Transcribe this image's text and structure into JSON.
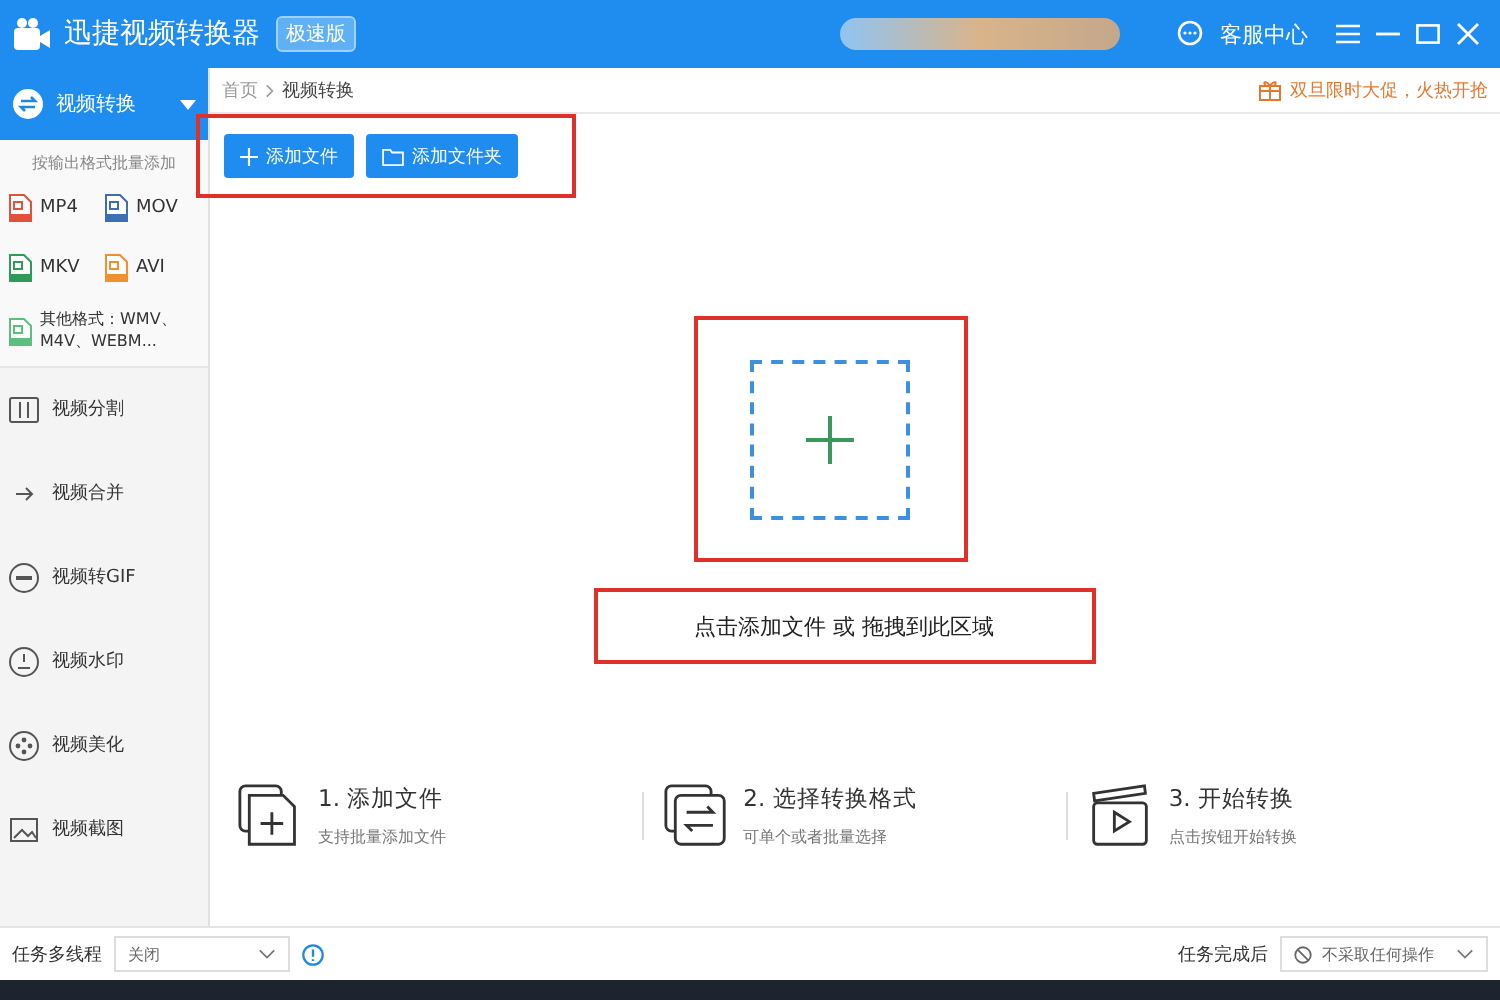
{
  "title_bar": {
    "app_name": "迅捷视频转换器",
    "edition_badge": "极速版",
    "support": "客服中心"
  },
  "sidebar": {
    "header": {
      "label": "视频转换",
      "selected": true
    },
    "hint": "按输出格式批量添加",
    "formats": [
      {
        "label": "MP4",
        "color": "#e0533a"
      },
      {
        "label": "MOV",
        "color": "#3b6fb6"
      },
      {
        "label": "MKV",
        "color": "#2e9b58"
      },
      {
        "label": "AVI",
        "color": "#f0902e"
      }
    ],
    "other_format": "其他格式：WMV、M4V、WEBM...",
    "items": [
      {
        "label": "视频分割",
        "kind": "split"
      },
      {
        "label": "视频合并",
        "kind": "merge"
      },
      {
        "label": "视频转GIF",
        "kind": "gif"
      },
      {
        "label": "视频水印",
        "kind": "watermark"
      },
      {
        "label": "视频美化",
        "kind": "beautify"
      },
      {
        "label": "视频截图",
        "kind": "screenshot"
      }
    ]
  },
  "breadcrumb": [
    "首页",
    "视频转换"
  ],
  "promo": "双旦限时大促，火热开抢",
  "buttons": [
    {
      "label": "添加文件",
      "kind": "file"
    },
    {
      "label": "添加文件夹",
      "kind": "folder"
    }
  ],
  "drop_hint": "点击添加文件 或 拖拽到此区域",
  "steps": [
    {
      "title": "1. 添加文件",
      "desc": "支持批量添加文件",
      "kind": "add"
    },
    {
      "title": "2. 选择转换格式",
      "desc": "可单个或者批量选择",
      "kind": "format"
    },
    {
      "title": "3. 开始转换",
      "desc": "点击按钮开始转换",
      "kind": "start"
    }
  ],
  "status_bar": {
    "multithread_label": "任务多线程",
    "multithread_value": "关闭",
    "after_label": "任务完成后",
    "after_value": "不采取任何操作"
  }
}
